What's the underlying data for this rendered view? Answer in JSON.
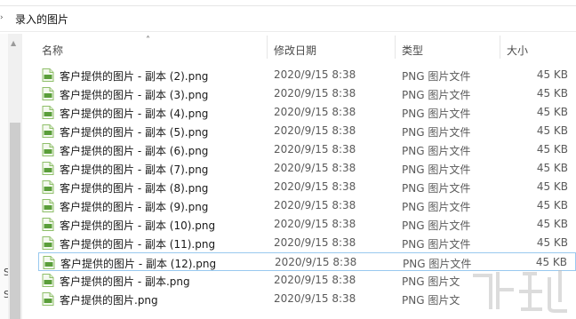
{
  "breadcrumb": {
    "folder": "录入的图片"
  },
  "columns": {
    "name": "名称",
    "date": "修改日期",
    "type": "类型",
    "size": "大小"
  },
  "files": [
    {
      "name": "客户提供的图片 - 副本 (2).png",
      "date": "2020/9/15 8:38",
      "type": "PNG 图片文件",
      "size": "45 KB"
    },
    {
      "name": "客户提供的图片 - 副本 (3).png",
      "date": "2020/9/15 8:38",
      "type": "PNG 图片文件",
      "size": "45 KB"
    },
    {
      "name": "客户提供的图片 - 副本 (4).png",
      "date": "2020/9/15 8:38",
      "type": "PNG 图片文件",
      "size": "45 KB"
    },
    {
      "name": "客户提供的图片 - 副本 (5).png",
      "date": "2020/9/15 8:38",
      "type": "PNG 图片文件",
      "size": "45 KB"
    },
    {
      "name": "客户提供的图片 - 副本 (6).png",
      "date": "2020/9/15 8:38",
      "type": "PNG 图片文件",
      "size": "45 KB"
    },
    {
      "name": "客户提供的图片 - 副本 (7).png",
      "date": "2020/9/15 8:38",
      "type": "PNG 图片文件",
      "size": "45 KB"
    },
    {
      "name": "客户提供的图片 - 副本 (8).png",
      "date": "2020/9/15 8:38",
      "type": "PNG 图片文件",
      "size": "45 KB"
    },
    {
      "name": "客户提供的图片 - 副本 (9).png",
      "date": "2020/9/15 8:38",
      "type": "PNG 图片文件",
      "size": "45 KB"
    },
    {
      "name": "客户提供的图片 - 副本 (10).png",
      "date": "2020/9/15 8:38",
      "type": "PNG 图片文件",
      "size": "45 KB"
    },
    {
      "name": "客户提供的图片 - 副本 (11).png",
      "date": "2020/9/15 8:38",
      "type": "PNG 图片文件",
      "size": "45 KB"
    },
    {
      "name": "客户提供的图片 - 副本 (12).png",
      "date": "2020/9/15 8:38",
      "type": "PNG 图片文件",
      "size": "45 KB"
    },
    {
      "name": "客户提供的图片 - 副本.png",
      "date": "2020/9/15 8:38",
      "type": "PNG 图片文",
      "size": ""
    },
    {
      "name": "客户提供的图片.png",
      "date": "2020/9/15 8:38",
      "type": "PNG 图片文",
      "size": ""
    }
  ],
  "selected_file": "客户提供的图片 - 副本 (12).png",
  "colors": {
    "selection_border": "#99c9ef",
    "icon_green": "#5a9e3a"
  },
  "icons": {
    "file": "png-file-icon",
    "sort": "sort-up-icon"
  }
}
